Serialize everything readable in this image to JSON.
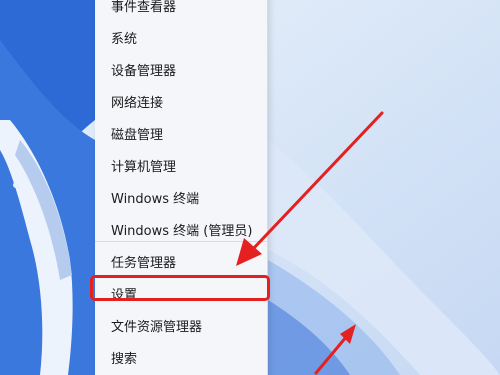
{
  "colors": {
    "menu_background": "#f4f6fa",
    "highlight": "#e52020",
    "annotation_arrow": "#e52020"
  },
  "context_menu": {
    "items": [
      {
        "label": "事件查看器"
      },
      {
        "label": "系统"
      },
      {
        "label": "设备管理器"
      },
      {
        "label": "网络连接"
      },
      {
        "label": "磁盘管理"
      },
      {
        "label": "计算机管理"
      },
      {
        "label": "Windows 终端"
      },
      {
        "label": "Windows 终端 (管理员)"
      },
      {
        "label": "任务管理器"
      },
      {
        "label": "设置"
      },
      {
        "label": "文件资源管理器"
      },
      {
        "label": "搜索"
      }
    ],
    "highlighted_item": "设置"
  }
}
